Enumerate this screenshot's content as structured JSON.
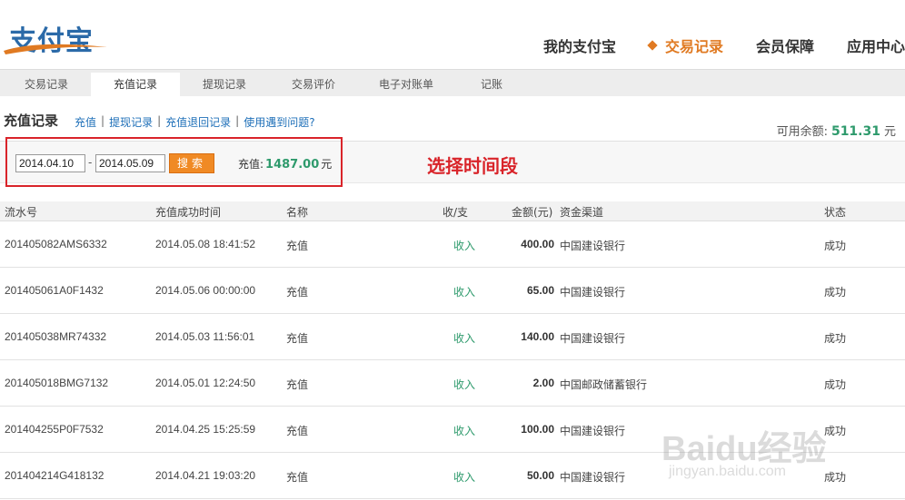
{
  "logo": {
    "text": "支付宝"
  },
  "topnav": {
    "items": [
      {
        "label": "我的支付宝",
        "active": false
      },
      {
        "label": "交易记录",
        "active": true
      },
      {
        "label": "会员保障",
        "active": false
      },
      {
        "label": "应用中心",
        "active": false
      }
    ]
  },
  "subnav": {
    "tabs": [
      {
        "label": "交易记录",
        "active": false
      },
      {
        "label": "充值记录",
        "active": true
      },
      {
        "label": "提现记录",
        "active": false
      },
      {
        "label": "交易评价",
        "active": false
      },
      {
        "label": "电子对账单",
        "active": false
      },
      {
        "label": "记账",
        "active": false
      }
    ]
  },
  "section": {
    "title": "充值记录",
    "links": [
      "充值",
      "提现记录",
      "充值退回记录",
      "使用遇到问题?"
    ],
    "balance_label": "可用余额:",
    "balance_value": "511.31",
    "balance_unit": "元"
  },
  "filter": {
    "start_date": "2014.04.10",
    "date_separator": "-",
    "end_date": "2014.05.09",
    "search_label": "搜索",
    "total_label": "充值:",
    "total_value": "1487.00",
    "total_unit": "元",
    "annotation": "选择时间段"
  },
  "table": {
    "headers": [
      "流水号",
      "充值成功时间",
      "名称",
      "收/支",
      "金额(元)",
      "资金渠道",
      "状态"
    ],
    "rows": [
      {
        "id": "201405082AMS6332",
        "time": "2014.05.08 18:41:52",
        "name": "充值",
        "dir": "收入",
        "amount": "400.00",
        "channel": "中国建设银行",
        "status": "成功"
      },
      {
        "id": "201405061A0F1432",
        "time": "2014.05.06 00:00:00",
        "name": "充值",
        "dir": "收入",
        "amount": "65.00",
        "channel": "中国建设银行",
        "status": "成功"
      },
      {
        "id": "201405038MR74332",
        "time": "2014.05.03 11:56:01",
        "name": "充值",
        "dir": "收入",
        "amount": "140.00",
        "channel": "中国建设银行",
        "status": "成功"
      },
      {
        "id": "201405018BMG7132",
        "time": "2014.05.01 12:24:50",
        "name": "充值",
        "dir": "收入",
        "amount": "2.00",
        "channel": "中国邮政储蓄银行",
        "status": "成功"
      },
      {
        "id": "201404255P0F7532",
        "time": "2014.04.25 15:25:59",
        "name": "充值",
        "dir": "收入",
        "amount": "100.00",
        "channel": "中国建设银行",
        "status": "成功"
      },
      {
        "id": "201404214G418132",
        "time": "2014.04.21 19:03:20",
        "name": "充值",
        "dir": "收入",
        "amount": "50.00",
        "channel": "中国建设银行",
        "status": "成功"
      }
    ]
  },
  "watermark": {
    "text": "Baidu经验",
    "sub": "jingyan.baidu.com"
  }
}
